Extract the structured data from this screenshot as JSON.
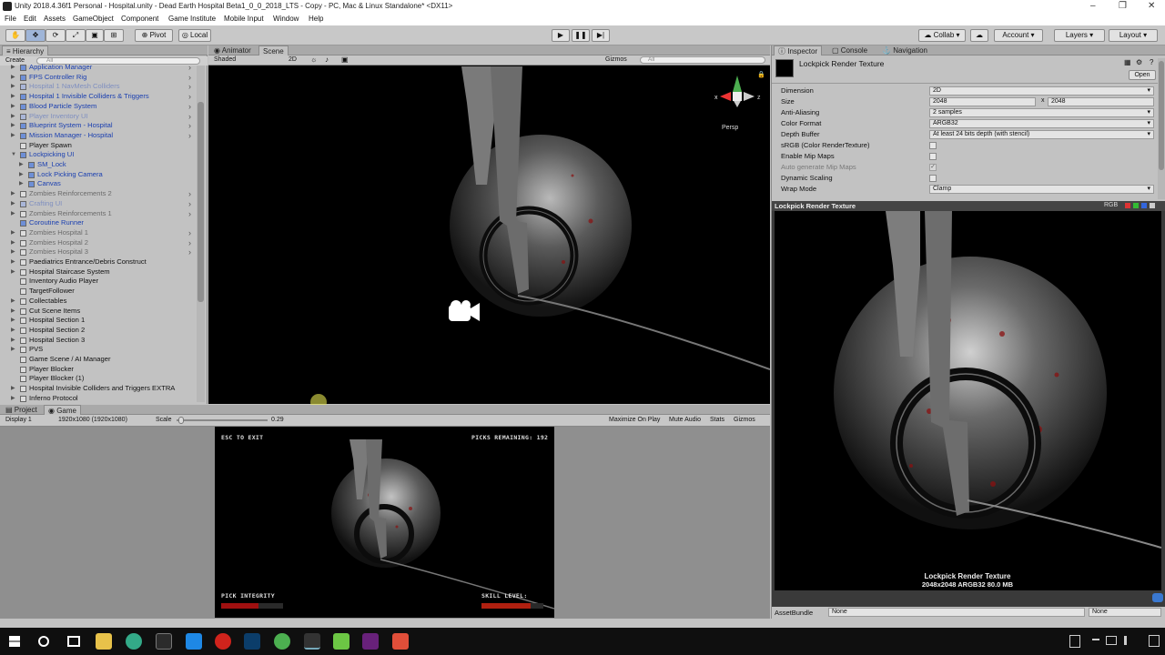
{
  "window": {
    "title": "Unity 2018.4.36f1 Personal - Hospital.unity - Dead Earth Hospital Beta1_0_0_2018_LTS - Copy - PC, Mac & Linux Standalone* <DX11>"
  },
  "menu": [
    "File",
    "Edit",
    "Assets",
    "GameObject",
    "Component",
    "Game Institute",
    "Mobile Input",
    "Window",
    "Help"
  ],
  "toolbar": {
    "pivot": "Pivot",
    "local": "Local",
    "collab": "Collab",
    "account": "Account",
    "layers": "Layers",
    "layout": "Layout"
  },
  "hierarchy": {
    "tab": "Hierarchy",
    "create": "Create",
    "search": "All",
    "items": [
      {
        "label": "Application Manager",
        "style": "blue",
        "indent": 0,
        "arrow": "▶"
      },
      {
        "label": "FPS Controller Rig",
        "style": "blue",
        "indent": 0,
        "arrow": "▶"
      },
      {
        "label": "Hospital 1 NavMesh Colliders",
        "style": "dimblue",
        "indent": 0,
        "arrow": "▶"
      },
      {
        "label": "Hospital 1 Invisible Colliders & Triggers",
        "style": "blue",
        "indent": 0,
        "arrow": "▶"
      },
      {
        "label": "Blood Particle System",
        "style": "blue",
        "indent": 0,
        "arrow": "▶"
      },
      {
        "label": "Player Inventory UI",
        "style": "dimblue",
        "indent": 0,
        "arrow": "▶"
      },
      {
        "label": "Blueprint System - Hospital",
        "style": "blue",
        "indent": 0,
        "arrow": "▶"
      },
      {
        "label": "Mission Manager - Hospital",
        "style": "blue",
        "indent": 0,
        "arrow": "▶"
      },
      {
        "label": "Player Spawn",
        "style": "",
        "indent": 0,
        "arrow": ""
      },
      {
        "label": "Lockpicking UI",
        "style": "blue",
        "indent": 0,
        "arrow": "▼"
      },
      {
        "label": "SM_Lock",
        "style": "blue",
        "indent": 1,
        "arrow": "▶"
      },
      {
        "label": "Lock Picking Camera",
        "style": "blue",
        "indent": 1,
        "arrow": "▶"
      },
      {
        "label": "Canvas",
        "style": "blue",
        "indent": 1,
        "arrow": "▶"
      },
      {
        "label": "Zombies Reinforcements 2",
        "style": "dim",
        "indent": 0,
        "arrow": "▶"
      },
      {
        "label": "Crafting UI",
        "style": "dimblue",
        "indent": 0,
        "arrow": "▶"
      },
      {
        "label": "Zombies Reinforcements 1",
        "style": "dim",
        "indent": 0,
        "arrow": "▶"
      },
      {
        "label": "Coroutine Runner",
        "style": "blue",
        "indent": 0,
        "arrow": ""
      },
      {
        "label": "Zombies Hospital 1",
        "style": "dim",
        "indent": 0,
        "arrow": "▶"
      },
      {
        "label": "Zombies Hospital 2",
        "style": "dim",
        "indent": 0,
        "arrow": "▶"
      },
      {
        "label": "Zombies Hospital 3",
        "style": "dim",
        "indent": 0,
        "arrow": "▶"
      },
      {
        "label": "Paediatrics Entrance/Debris Construct",
        "style": "",
        "indent": 0,
        "arrow": "▶"
      },
      {
        "label": "Hospital Staircase System",
        "style": "",
        "indent": 0,
        "arrow": "▶"
      },
      {
        "label": "Inventory Audio Player",
        "style": "",
        "indent": 0,
        "arrow": ""
      },
      {
        "label": "TargetFollower",
        "style": "",
        "indent": 0,
        "arrow": ""
      },
      {
        "label": "Collectables",
        "style": "",
        "indent": 0,
        "arrow": "▶"
      },
      {
        "label": "Cut Scene Items",
        "style": "",
        "indent": 0,
        "arrow": "▶"
      },
      {
        "label": "Hospital Section 1",
        "style": "",
        "indent": 0,
        "arrow": "▶"
      },
      {
        "label": "Hospital Section 2",
        "style": "",
        "indent": 0,
        "arrow": "▶"
      },
      {
        "label": "Hospital Section 3",
        "style": "",
        "indent": 0,
        "arrow": "▶"
      },
      {
        "label": "PVS",
        "style": "",
        "indent": 0,
        "arrow": "▶"
      },
      {
        "label": "Game Scene / AI Manager",
        "style": "",
        "indent": 0,
        "arrow": ""
      },
      {
        "label": "Player Blocker",
        "style": "",
        "indent": 0,
        "arrow": ""
      },
      {
        "label": "Player Blocker (1)",
        "style": "",
        "indent": 0,
        "arrow": ""
      },
      {
        "label": "Hospital Invisible Colliders and Triggers EXTRA",
        "style": "",
        "indent": 0,
        "arrow": "▶"
      },
      {
        "label": "Inferno Protocol",
        "style": "",
        "indent": 0,
        "arrow": "▶"
      }
    ]
  },
  "scene": {
    "tab_animator": "Animator",
    "tab_scene": "Scene",
    "shading": "Shaded",
    "mode2d": "2D",
    "gizmos": "Gizmos",
    "search": "All",
    "persp": "Persp"
  },
  "game": {
    "tab_project": "Project",
    "tab_game": "Game",
    "display": "Display 1",
    "resolution": "1920x1080 (1920x1080)",
    "scale_label": "Scale",
    "scale_value": "0.29",
    "scale_level": 0.02,
    "maximize": "Maximize On Play",
    "mute": "Mute Audio",
    "stats": "Stats",
    "gizmos": "Gizmos",
    "hud": {
      "esc": "ESC TO EXIT",
      "picks": "PICKS REMAINING: 192",
      "integrity": "PICK INTEGRITY",
      "skill": "SKILL LEVEL:",
      "integrity_level": 0.6,
      "skill_level": 0.8
    }
  },
  "inspector": {
    "tab_inspector": "Inspector",
    "tab_console": "Console",
    "tab_navigation": "Navigation",
    "object_name": "Lockpick Render Texture",
    "open": "Open",
    "props": [
      {
        "label": "Dimension",
        "value": "2D",
        "type": "dropdown"
      },
      {
        "label": "Size",
        "value": "2048",
        "value2": "2048",
        "type": "size"
      },
      {
        "label": "Anti-Aliasing",
        "value": "2 samples",
        "type": "dropdown"
      },
      {
        "label": "Color Format",
        "value": "ARGB32",
        "type": "dropdown"
      },
      {
        "label": "Depth Buffer",
        "value": "At least 24 bits depth (with stencil)",
        "type": "dropdown"
      },
      {
        "label": "sRGB (Color RenderTexture)",
        "type": "check",
        "checked": false
      },
      {
        "label": "Enable Mip Maps",
        "type": "check",
        "checked": false
      },
      {
        "label": "Auto generate Mip Maps",
        "type": "check",
        "checked": true,
        "dim": true
      },
      {
        "label": "Dynamic Scaling",
        "type": "check",
        "checked": false
      },
      {
        "label": "Wrap Mode",
        "value": "Clamp",
        "type": "dropdown"
      }
    ],
    "preview_title": "Lockpick Render Texture",
    "preview_channels": "RGB",
    "preview_caption1": "Lockpick Render Texture",
    "preview_caption2": "2048x2048  ARGB32  80.0 MB",
    "assetbundle_label": "AssetBundle",
    "assetbundle_value": "None",
    "assetbundle_variant": "None"
  }
}
